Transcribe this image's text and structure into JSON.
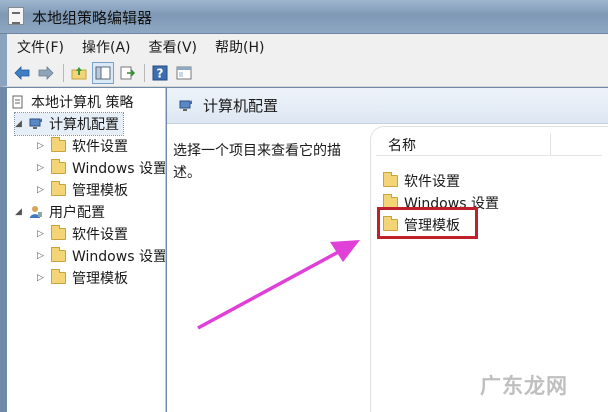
{
  "window": {
    "title": "本地组策略编辑器"
  },
  "menu": [
    "文件(F)",
    "操作(A)",
    "查看(V)",
    "帮助(H)"
  ],
  "toolbar_icons": [
    "back-arrow-icon",
    "forward-arrow-icon",
    "up-folder-icon",
    "show-hide-tree-icon",
    "export-list-icon",
    "help-icon",
    "properties-icon"
  ],
  "tree": {
    "root": "本地计算机 策略",
    "computer_config": "计算机配置",
    "computer_children": [
      "软件设置",
      "Windows 设置",
      "管理模板"
    ],
    "user_config": "用户配置",
    "user_children": [
      "软件设置",
      "Windows 设置",
      "管理模板"
    ]
  },
  "right": {
    "header": "计算机配置",
    "description": "选择一个项目来查看它的描述。",
    "column_name": "名称",
    "items": [
      "软件设置",
      "Windows 设置",
      "管理模板"
    ],
    "highlighted_item": "管理模板"
  },
  "watermark": "广东龙网",
  "colors": {
    "highlight": "#c0202b",
    "arrow": "#e040d8",
    "folder": "#f3d577"
  }
}
